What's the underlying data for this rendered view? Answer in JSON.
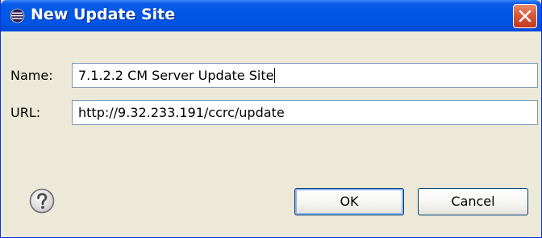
{
  "window": {
    "title": "New Update Site",
    "title_icon": "eclipse-icon",
    "close_icon": "close-icon"
  },
  "form": {
    "name_label": "Name:",
    "name_value": "7.1.2.2 CM Server Update Site",
    "url_label": "URL:",
    "url_value": "http://9.32.233.191/ccrc/update"
  },
  "footer": {
    "help_icon": "help-icon",
    "ok_label": "OK",
    "cancel_label": "Cancel"
  },
  "colors": {
    "titlebar": "#0054e3",
    "dialog_bg": "#ece9d8",
    "close_button": "#d9573a"
  }
}
